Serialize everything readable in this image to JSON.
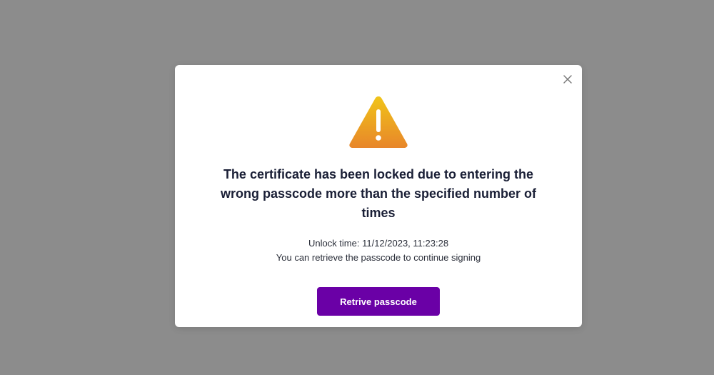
{
  "dialog": {
    "close_icon": "close-icon",
    "warning_icon": "warning-triangle-icon",
    "title": "The certificate has been locked due to entering the wrong passcode more than the specified number of times",
    "unlock_time": "Unlock time: 11/12/2023, 11:23:28",
    "message": "You can retrieve the passcode to continue signing",
    "button_label": "Retrive passcode"
  },
  "colors": {
    "backdrop": "#8c8c8c",
    "modal_bg": "#ffffff",
    "button_bg": "#6a00a6",
    "warning_top": "#f0c419",
    "warning_bottom": "#e8862a",
    "title_text": "#1a1f36"
  }
}
